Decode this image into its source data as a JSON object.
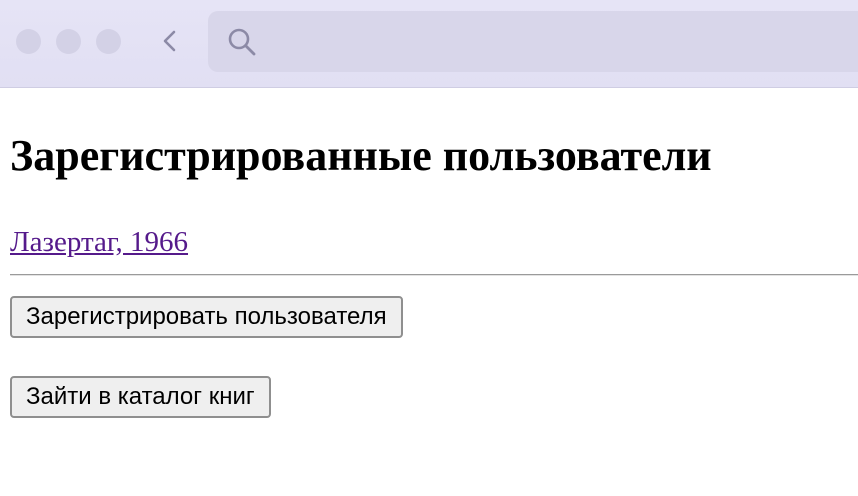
{
  "browser": {
    "traffic_lights": [
      "close",
      "minimize",
      "zoom"
    ],
    "back_icon": "chevron-left-icon",
    "search_icon": "search-icon",
    "address_value": ""
  },
  "page": {
    "title": "Зарегистрированные пользователи",
    "users": [
      {
        "label": "Лазертаг, 1966"
      }
    ],
    "buttons": {
      "register_label": "Зарегистрировать пользователя",
      "catalog_label": "Зайти в каталог книг"
    }
  },
  "colors": {
    "link": "#551a8b",
    "browser_bar": "#e3e1f5",
    "address_bar": "#d8d6ea",
    "button_bg": "#efefef"
  }
}
